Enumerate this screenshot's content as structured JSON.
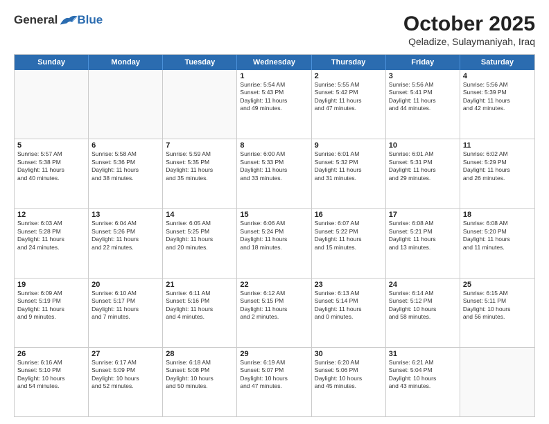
{
  "header": {
    "logo": {
      "general": "General",
      "blue": "Blue"
    },
    "month": "October 2025",
    "location": "Qeladize, Sulaymaniyah, Iraq"
  },
  "weekdays": [
    "Sunday",
    "Monday",
    "Tuesday",
    "Wednesday",
    "Thursday",
    "Friday",
    "Saturday"
  ],
  "weeks": [
    [
      {
        "day": "",
        "info": ""
      },
      {
        "day": "",
        "info": ""
      },
      {
        "day": "",
        "info": ""
      },
      {
        "day": "1",
        "info": "Sunrise: 5:54 AM\nSunset: 5:43 PM\nDaylight: 11 hours\nand 49 minutes."
      },
      {
        "day": "2",
        "info": "Sunrise: 5:55 AM\nSunset: 5:42 PM\nDaylight: 11 hours\nand 47 minutes."
      },
      {
        "day": "3",
        "info": "Sunrise: 5:56 AM\nSunset: 5:41 PM\nDaylight: 11 hours\nand 44 minutes."
      },
      {
        "day": "4",
        "info": "Sunrise: 5:56 AM\nSunset: 5:39 PM\nDaylight: 11 hours\nand 42 minutes."
      }
    ],
    [
      {
        "day": "5",
        "info": "Sunrise: 5:57 AM\nSunset: 5:38 PM\nDaylight: 11 hours\nand 40 minutes."
      },
      {
        "day": "6",
        "info": "Sunrise: 5:58 AM\nSunset: 5:36 PM\nDaylight: 11 hours\nand 38 minutes."
      },
      {
        "day": "7",
        "info": "Sunrise: 5:59 AM\nSunset: 5:35 PM\nDaylight: 11 hours\nand 35 minutes."
      },
      {
        "day": "8",
        "info": "Sunrise: 6:00 AM\nSunset: 5:33 PM\nDaylight: 11 hours\nand 33 minutes."
      },
      {
        "day": "9",
        "info": "Sunrise: 6:01 AM\nSunset: 5:32 PM\nDaylight: 11 hours\nand 31 minutes."
      },
      {
        "day": "10",
        "info": "Sunrise: 6:01 AM\nSunset: 5:31 PM\nDaylight: 11 hours\nand 29 minutes."
      },
      {
        "day": "11",
        "info": "Sunrise: 6:02 AM\nSunset: 5:29 PM\nDaylight: 11 hours\nand 26 minutes."
      }
    ],
    [
      {
        "day": "12",
        "info": "Sunrise: 6:03 AM\nSunset: 5:28 PM\nDaylight: 11 hours\nand 24 minutes."
      },
      {
        "day": "13",
        "info": "Sunrise: 6:04 AM\nSunset: 5:26 PM\nDaylight: 11 hours\nand 22 minutes."
      },
      {
        "day": "14",
        "info": "Sunrise: 6:05 AM\nSunset: 5:25 PM\nDaylight: 11 hours\nand 20 minutes."
      },
      {
        "day": "15",
        "info": "Sunrise: 6:06 AM\nSunset: 5:24 PM\nDaylight: 11 hours\nand 18 minutes."
      },
      {
        "day": "16",
        "info": "Sunrise: 6:07 AM\nSunset: 5:22 PM\nDaylight: 11 hours\nand 15 minutes."
      },
      {
        "day": "17",
        "info": "Sunrise: 6:08 AM\nSunset: 5:21 PM\nDaylight: 11 hours\nand 13 minutes."
      },
      {
        "day": "18",
        "info": "Sunrise: 6:08 AM\nSunset: 5:20 PM\nDaylight: 11 hours\nand 11 minutes."
      }
    ],
    [
      {
        "day": "19",
        "info": "Sunrise: 6:09 AM\nSunset: 5:19 PM\nDaylight: 11 hours\nand 9 minutes."
      },
      {
        "day": "20",
        "info": "Sunrise: 6:10 AM\nSunset: 5:17 PM\nDaylight: 11 hours\nand 7 minutes."
      },
      {
        "day": "21",
        "info": "Sunrise: 6:11 AM\nSunset: 5:16 PM\nDaylight: 11 hours\nand 4 minutes."
      },
      {
        "day": "22",
        "info": "Sunrise: 6:12 AM\nSunset: 5:15 PM\nDaylight: 11 hours\nand 2 minutes."
      },
      {
        "day": "23",
        "info": "Sunrise: 6:13 AM\nSunset: 5:14 PM\nDaylight: 11 hours\nand 0 minutes."
      },
      {
        "day": "24",
        "info": "Sunrise: 6:14 AM\nSunset: 5:12 PM\nDaylight: 10 hours\nand 58 minutes."
      },
      {
        "day": "25",
        "info": "Sunrise: 6:15 AM\nSunset: 5:11 PM\nDaylight: 10 hours\nand 56 minutes."
      }
    ],
    [
      {
        "day": "26",
        "info": "Sunrise: 6:16 AM\nSunset: 5:10 PM\nDaylight: 10 hours\nand 54 minutes."
      },
      {
        "day": "27",
        "info": "Sunrise: 6:17 AM\nSunset: 5:09 PM\nDaylight: 10 hours\nand 52 minutes."
      },
      {
        "day": "28",
        "info": "Sunrise: 6:18 AM\nSunset: 5:08 PM\nDaylight: 10 hours\nand 50 minutes."
      },
      {
        "day": "29",
        "info": "Sunrise: 6:19 AM\nSunset: 5:07 PM\nDaylight: 10 hours\nand 47 minutes."
      },
      {
        "day": "30",
        "info": "Sunrise: 6:20 AM\nSunset: 5:06 PM\nDaylight: 10 hours\nand 45 minutes."
      },
      {
        "day": "31",
        "info": "Sunrise: 6:21 AM\nSunset: 5:04 PM\nDaylight: 10 hours\nand 43 minutes."
      },
      {
        "day": "",
        "info": ""
      }
    ]
  ]
}
